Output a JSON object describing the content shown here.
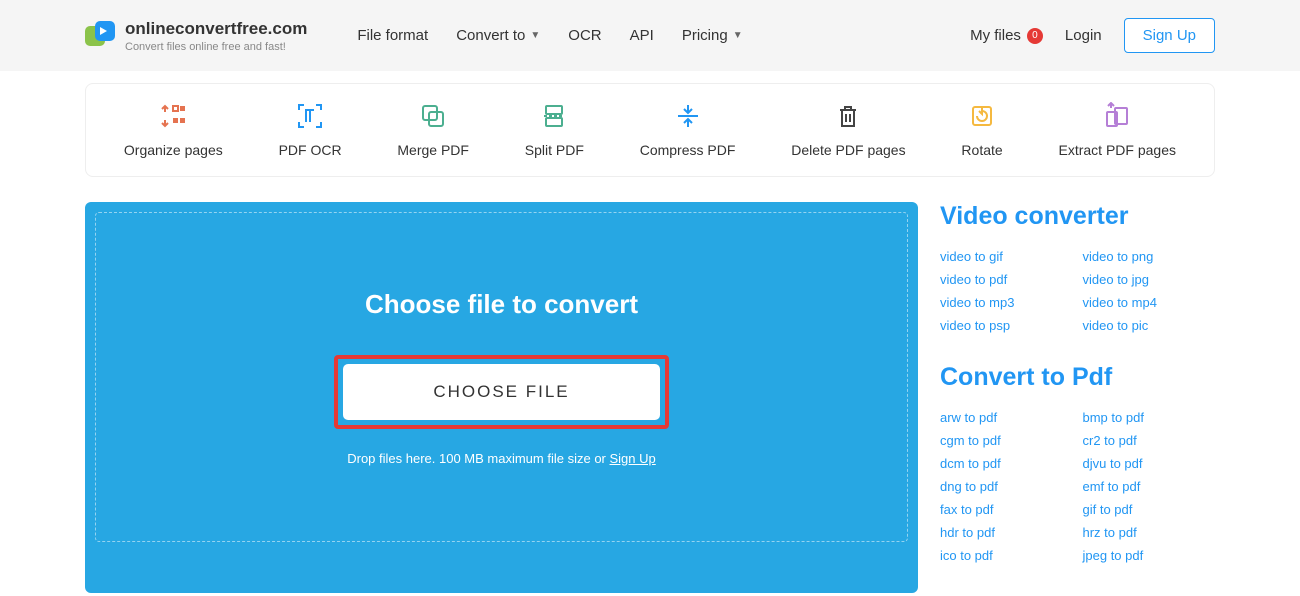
{
  "header": {
    "site_name": "onlineconvertfree.com",
    "tagline": "Convert files online free and fast!",
    "nav": [
      {
        "label": "File format",
        "dropdown": false
      },
      {
        "label": "Convert to",
        "dropdown": true
      },
      {
        "label": "OCR",
        "dropdown": false
      },
      {
        "label": "API",
        "dropdown": false
      },
      {
        "label": "Pricing",
        "dropdown": true
      }
    ],
    "my_files": "My files",
    "badge_count": "0",
    "login": "Login",
    "signup": "Sign Up"
  },
  "tools": [
    {
      "label": "Organize pages",
      "icon": "organize",
      "color": "#e57350"
    },
    {
      "label": "PDF OCR",
      "icon": "ocr",
      "color": "#2196f3"
    },
    {
      "label": "Merge PDF",
      "icon": "merge",
      "color": "#4caf90"
    },
    {
      "label": "Split PDF",
      "icon": "split",
      "color": "#4caf90"
    },
    {
      "label": "Compress PDF",
      "icon": "compress",
      "color": "#2196f3"
    },
    {
      "label": "Delete PDF pages",
      "icon": "delete",
      "color": "#444"
    },
    {
      "label": "Rotate",
      "icon": "rotate",
      "color": "#f5b940"
    },
    {
      "label": "Extract PDF pages",
      "icon": "extract",
      "color": "#b57fd6"
    }
  ],
  "drop": {
    "title": "Choose file to convert",
    "button": "CHOOSE FILE",
    "hint_prefix": "Drop files here. 100 MB maximum file size or ",
    "hint_link": "Sign Up"
  },
  "sidebar": {
    "sections": [
      {
        "title": "Video converter",
        "links_col1": [
          "video to gif",
          "video to pdf",
          "video to mp3",
          "video to psp"
        ],
        "links_col2": [
          "video to png",
          "video to jpg",
          "video to mp4",
          "video to pic"
        ]
      },
      {
        "title": "Convert to Pdf",
        "links_col1": [
          "arw to pdf",
          "cgm to pdf",
          "dcm to pdf",
          "dng to pdf",
          "fax to pdf",
          "hdr to pdf",
          "ico to pdf"
        ],
        "links_col2": [
          "bmp to pdf",
          "cr2 to pdf",
          "djvu to pdf",
          "emf to pdf",
          "gif to pdf",
          "hrz to pdf",
          "jpeg to pdf"
        ]
      }
    ]
  }
}
